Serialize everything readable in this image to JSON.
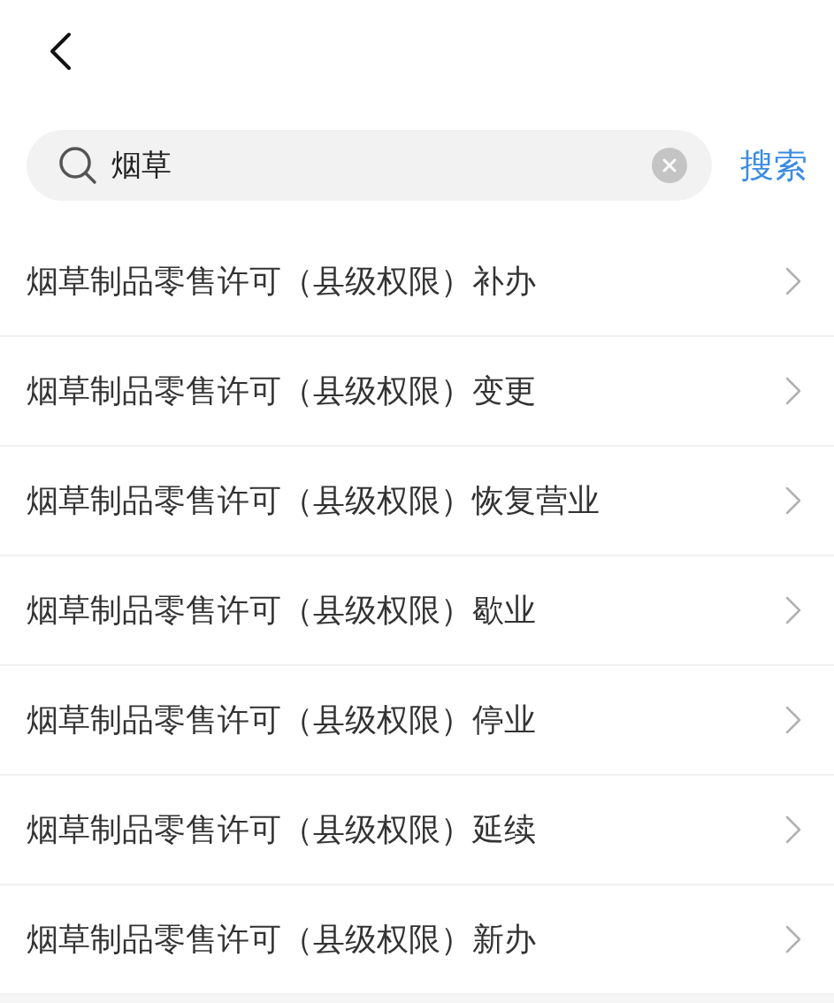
{
  "search": {
    "value": "烟草",
    "button": "搜索"
  },
  "results": [
    {
      "label": "烟草制品零售许可（县级权限）补办"
    },
    {
      "label": "烟草制品零售许可（县级权限）变更"
    },
    {
      "label": "烟草制品零售许可（县级权限）恢复营业"
    },
    {
      "label": "烟草制品零售许可（县级权限）歇业"
    },
    {
      "label": "烟草制品零售许可（县级权限）停业"
    },
    {
      "label": "烟草制品零售许可（县级权限）延续"
    },
    {
      "label": "烟草制品零售许可（县级权限）新办"
    }
  ]
}
